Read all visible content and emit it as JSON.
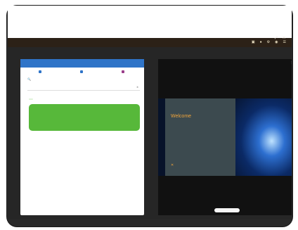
{
  "topbar": {
    "title": "",
    "icons": [
      "window-icon",
      "bell-icon",
      "settings-icon",
      "user-icon",
      "menu-icon"
    ]
  },
  "left": {
    "header": "",
    "tabs": [
      "",
      "",
      ""
    ],
    "section_title": "",
    "input_placeholder": "",
    "pills": [
      "",
      ""
    ],
    "card": {
      "heading": "",
      "message": "",
      "link": ""
    }
  },
  "right": {
    "header": "",
    "slide": {
      "welcome": "Welcome",
      "subtitle": "",
      "brand": ""
    },
    "button_label": ""
  },
  "colors": {
    "topbar": "#2c2117",
    "header_blue": "#2f74c8",
    "success_green": "#57b83a",
    "accent_orange": "#f0a43a"
  }
}
